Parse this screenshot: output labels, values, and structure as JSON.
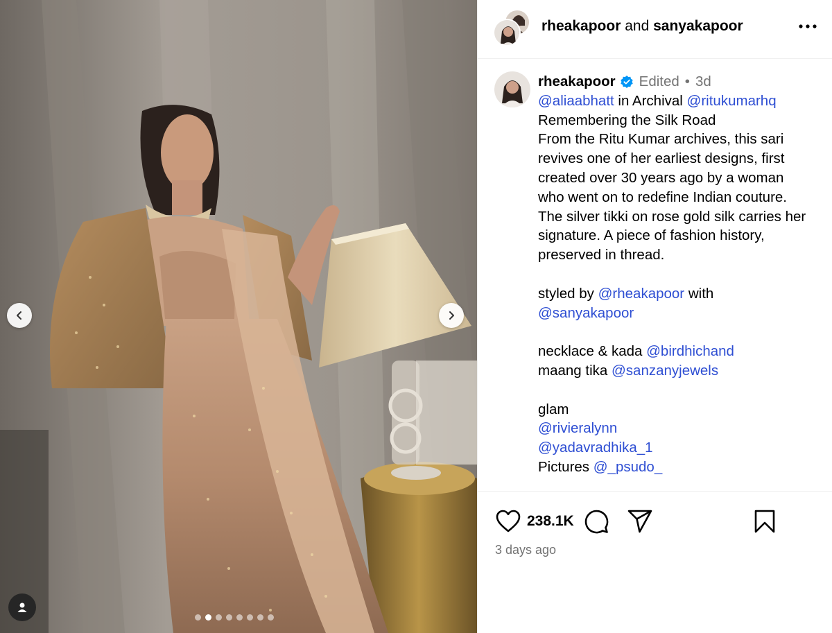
{
  "header": {
    "user1": "rheakapoor",
    "joiner": " and ",
    "user2": "sanyakapoor"
  },
  "carousel": {
    "slide_count": 8,
    "active_index": 1
  },
  "caption": {
    "username": "rheakapoor",
    "edited": "Edited",
    "dot": "•",
    "age": "3d",
    "line1_link1": "@aliaabhatt",
    "line1_text": " in Archival ",
    "line1_link2": "@ritukumarhq",
    "lines": [
      "Remembering the Silk Road",
      "From the Ritu Kumar archives, this sari",
      "revives one of her earliest designs, first",
      "created over 30 years ago by a woman",
      "who went on to redefine Indian couture.",
      "The silver tikki on rose gold silk carries her",
      "signature. A piece of fashion history,",
      "preserved in thread."
    ],
    "styled_text": "styled by ",
    "styled_link": "@rheakapoor",
    "styled_with": " with",
    "styled_link2": "@sanyakapoor",
    "necklace_text": "necklace & kada ",
    "necklace_link": "@birdhichand",
    "tika_text": "maang tika ",
    "tika_link": "@sanzanyjewels",
    "glam_text": "glam",
    "glam_link1": "@rivieralynn",
    "glam_link2": "@yadavradhika_1",
    "pictures_text": "Pictures ",
    "pictures_link": "@_psudo_"
  },
  "actions": {
    "likes": "238.1K",
    "timestamp": "3 days ago"
  },
  "colors": {
    "link": "#2f4fd3",
    "muted": "#737373",
    "verified": "#0095f6"
  },
  "icons": [
    "chevron-left-icon",
    "chevron-right-icon",
    "user-tag-icon",
    "more-icon",
    "verified-icon",
    "heart-icon",
    "comment-icon",
    "share-icon",
    "bookmark-icon"
  ]
}
